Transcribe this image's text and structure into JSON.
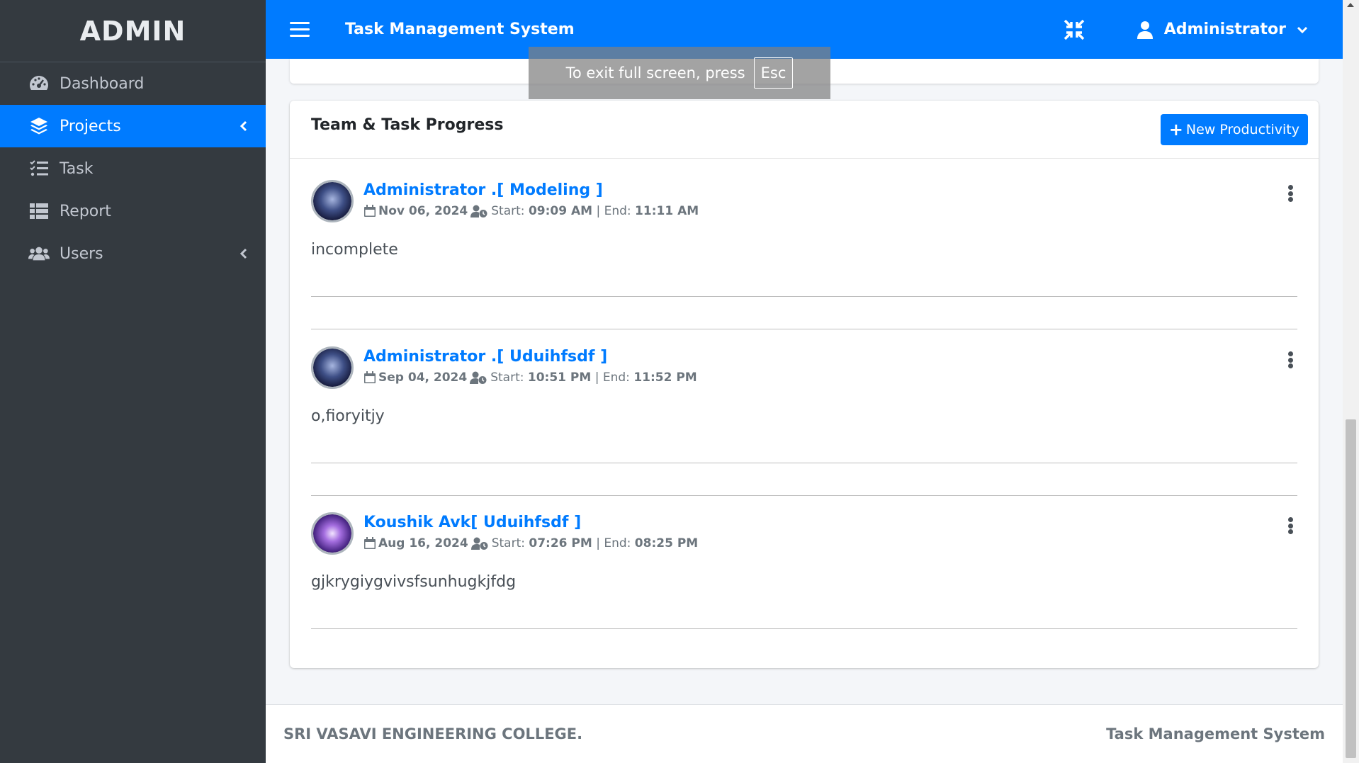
{
  "sidebar": {
    "brand": "ADMIN",
    "items": [
      {
        "label": "Dashboard",
        "icon": "tachometer-icon"
      },
      {
        "label": "Projects",
        "icon": "layers-icon"
      },
      {
        "label": "Task",
        "icon": "tasks-list-icon"
      },
      {
        "label": "Report",
        "icon": "table-list-icon"
      },
      {
        "label": "Users",
        "icon": "users-icon"
      }
    ]
  },
  "header": {
    "title": "Task Management System",
    "user": "Administrator"
  },
  "toast": {
    "text": "To exit full screen, press",
    "key": "Esc"
  },
  "card": {
    "title": "Team & Task Progress",
    "new_button": "New Productivity"
  },
  "posts": [
    {
      "user": "Administrator .[ Modeling ]",
      "date": "Nov 06, 2024",
      "start_label": "Start:",
      "start": "09:09 AM",
      "end_label": "End:",
      "end": "11:11 AM",
      "content": "incomplete"
    },
    {
      "user": "Administrator .[ Uduihfsdf ]",
      "date": "Sep 04, 2024",
      "start_label": "Start:",
      "start": "10:51 PM",
      "end_label": "End:",
      "end": "11:52 PM",
      "content": "o,fioryitjy"
    },
    {
      "user": "Koushik Avk[ Uduihfsdf ]",
      "date": "Aug 16, 2024",
      "start_label": "Start:",
      "start": "07:26 PM",
      "end_label": "End:",
      "end": "08:25 PM",
      "content": "gjkrygiygvivsfsunhugkjfdg"
    }
  ],
  "footer": {
    "left": "SRI VASAVI ENGINEERING COLLEGE.",
    "right": "Task Management System"
  },
  "colors": {
    "primary": "#007bff",
    "sidebar": "#343a40",
    "background": "#f4f6f9"
  }
}
